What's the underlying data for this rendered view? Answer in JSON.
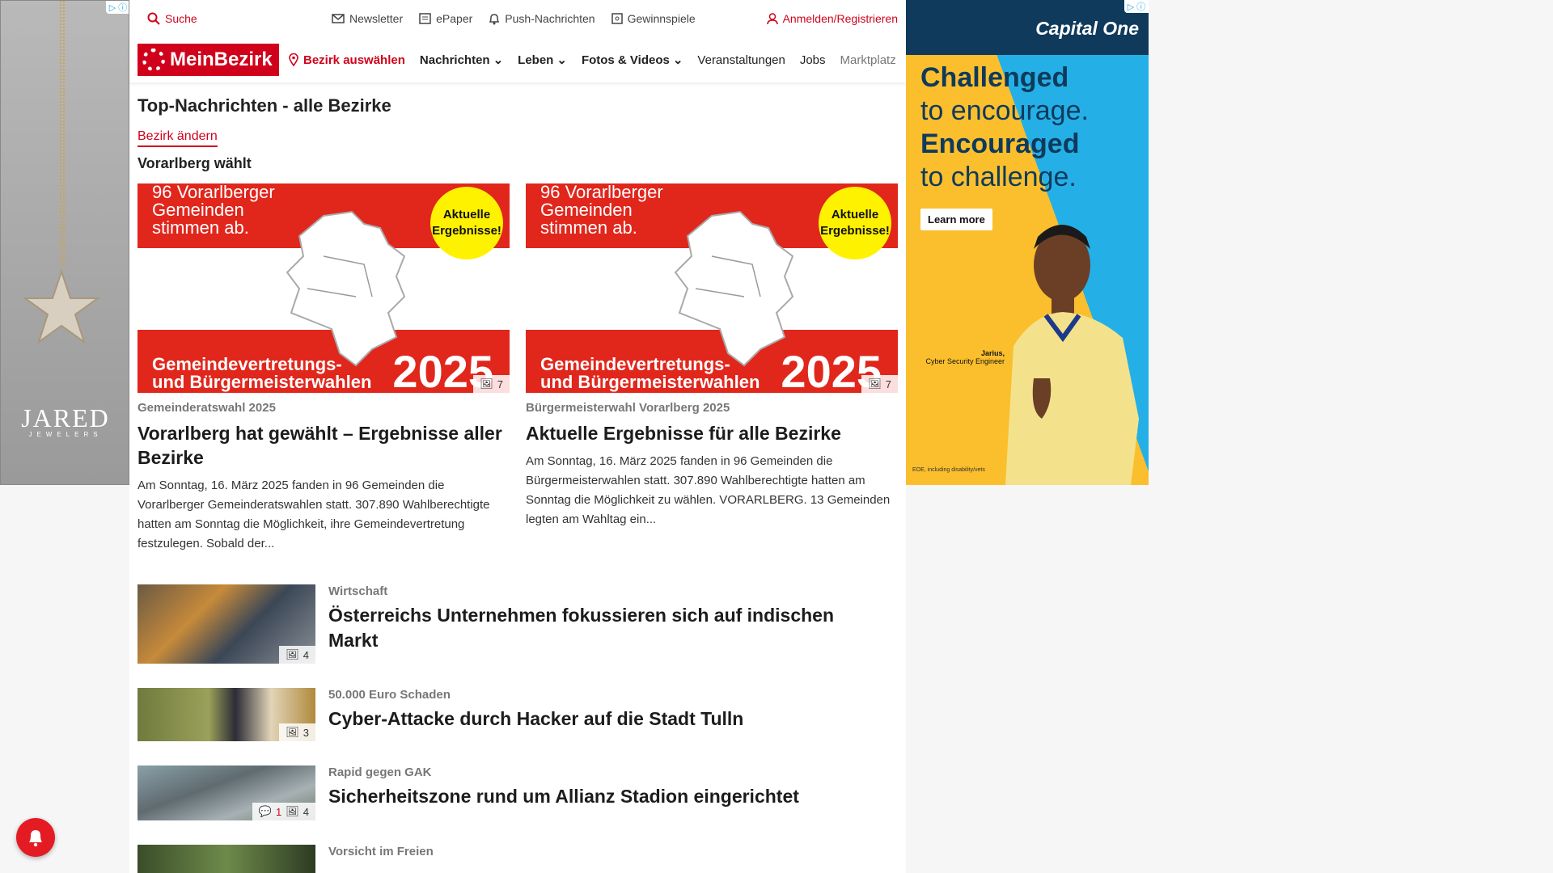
{
  "ads": {
    "left": {
      "brand": "JARED",
      "brand_sub": "JEWELERS"
    },
    "right": {
      "logo": "Capital One",
      "line1": "Challenged",
      "line2": "to encourage.",
      "line3": "Encouraged",
      "line4": "to challenge.",
      "cta": "Learn more",
      "caption_name": "Jarius,",
      "caption_role": "Cyber Security Engineer",
      "fine_print": "EOE, including disability/vets"
    }
  },
  "topbar": {
    "search": "Suche",
    "links": [
      "Newsletter",
      "ePaper",
      "Push-Nachrichten",
      "Gewinnspiele"
    ],
    "login": "Anmelden/Registrieren"
  },
  "navbar": {
    "logo": "MeinBezirk",
    "district": "Bezirk auswählen",
    "items": [
      "Nachrichten",
      "Leben",
      "Fotos & Videos",
      "Veranstaltungen",
      "Jobs",
      "Marktplatz"
    ]
  },
  "page": {
    "title": "Top-Nachrichten - alle Bezirke",
    "change_district": "Bezirk ändern",
    "section": "Vorarlberg wählt"
  },
  "featured_image": {
    "top_line1": "96 Vorarlberger",
    "top_line2": "Gemeinden",
    "top_line3": "stimmen ab.",
    "badge_line1": "Aktuelle",
    "badge_line2": "Ergebnisse!",
    "bottom_line1": "Gemeindevertretungs-",
    "bottom_line2": "und Bürgermeisterwahlen",
    "year": "2025"
  },
  "featured": [
    {
      "gallery_count": "7",
      "kicker": "Gemeinderatswahl 2025",
      "title": "Vorarlberg hat gewählt – Ergebnisse aller Bezirke",
      "text": "Am Sonntag, 16. März 2025 fanden in 96 Gemeinden die Vorarlberger Gemeinderatswahlen statt. 307.890 Wahlberechtigte hatten am Sonntag die Möglichkeit, ihre Gemeindevertretung festzulegen. Sobald der..."
    },
    {
      "gallery_count": "7",
      "kicker": "Bürgermeisterwahl Vorarlberg 2025",
      "title": "Aktuelle Ergebnisse für alle Bezirke",
      "text": "Am Sonntag, 16. März 2025 fanden in 96 Gemeinden die Bürgermeisterwahlen statt. 307.890 Wahlberechtigte hatten am Sonntag die Möglichkeit zu wählen. VORARLBERG. 13 Gemeinden legten am Wahltag ein..."
    }
  ],
  "articles": [
    {
      "kicker": "Wirtschaft",
      "title": "Österreichs Unternehmen fokussieren sich auf indischen Markt",
      "gallery_count": "4"
    },
    {
      "kicker": "50.000 Euro Schaden",
      "title": "Cyber-Attacke durch Hacker auf die Stadt Tulln",
      "gallery_count": "3"
    },
    {
      "kicker": "Rapid gegen GAK",
      "title": "Sicherheitszone rund um Allianz Stadion eingerichtet",
      "comment_count": "1",
      "gallery_count": "4"
    },
    {
      "kicker": "Vorsicht im Freien",
      "title": ""
    }
  ],
  "colors": {
    "brand_red": "#d0021b",
    "navy": "#0f3a5c",
    "yellow": "#fbbf2d",
    "cyan": "#24b0e6"
  }
}
